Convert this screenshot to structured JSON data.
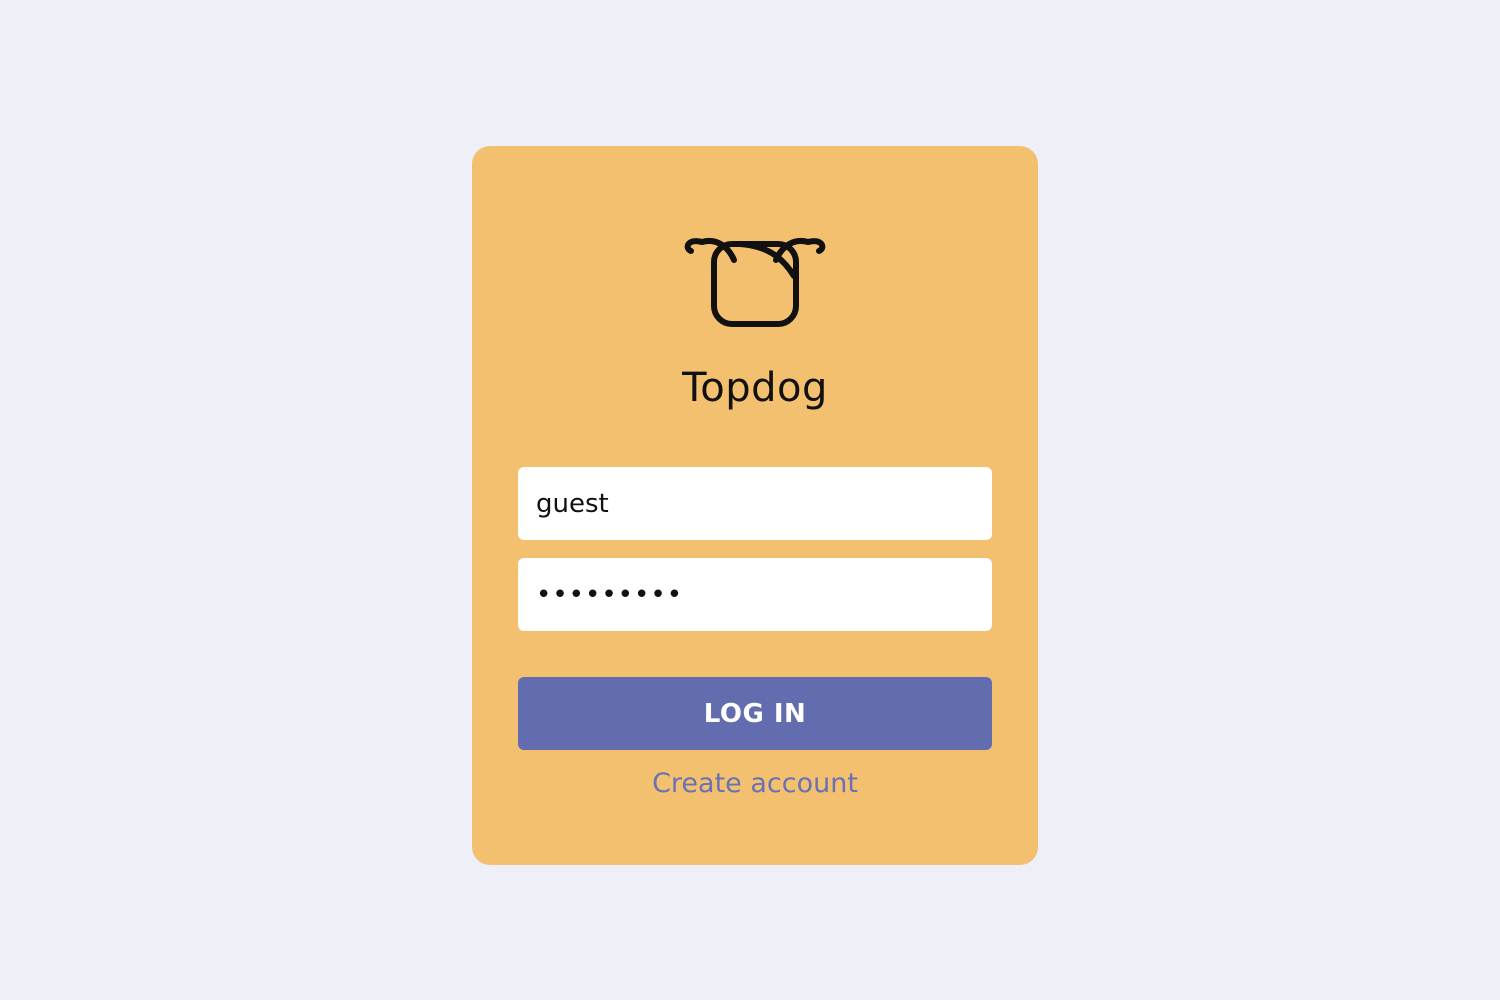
{
  "brand": {
    "name": "Topdog",
    "logo_icon": "dog-head-icon"
  },
  "form": {
    "username_value": "guest",
    "password_value": "•••••••••",
    "login_label": "LOG IN",
    "create_account_label": "Create account"
  },
  "colors": {
    "page_background": "#efeff8",
    "card_background": "#f3c070",
    "button_background": "#626cae",
    "link_color": "#6a72b3"
  }
}
